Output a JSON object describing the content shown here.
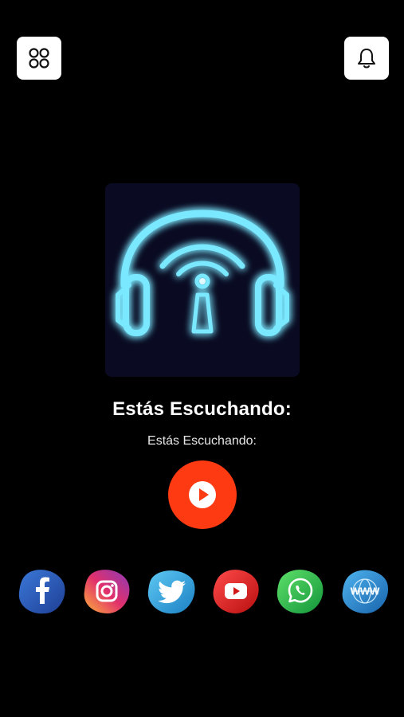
{
  "header": {
    "menu_icon": "grid-menu-icon",
    "notification_icon": "bell-icon"
  },
  "artwork": {
    "icon": "neon-headphones-radio-icon",
    "glow_color": "#7ae8ff"
  },
  "player": {
    "title": "Estás Escuchando:",
    "subtitle": "Estás Escuchando:",
    "play_icon": "play-icon",
    "play_color": "#fe3a13"
  },
  "social": [
    {
      "name": "facebook",
      "icon": "facebook-icon"
    },
    {
      "name": "instagram",
      "icon": "instagram-icon"
    },
    {
      "name": "twitter",
      "icon": "twitter-icon"
    },
    {
      "name": "youtube",
      "icon": "youtube-icon"
    },
    {
      "name": "whatsapp",
      "icon": "whatsapp-icon"
    },
    {
      "name": "website",
      "icon": "www-icon",
      "label": "WWW"
    }
  ]
}
